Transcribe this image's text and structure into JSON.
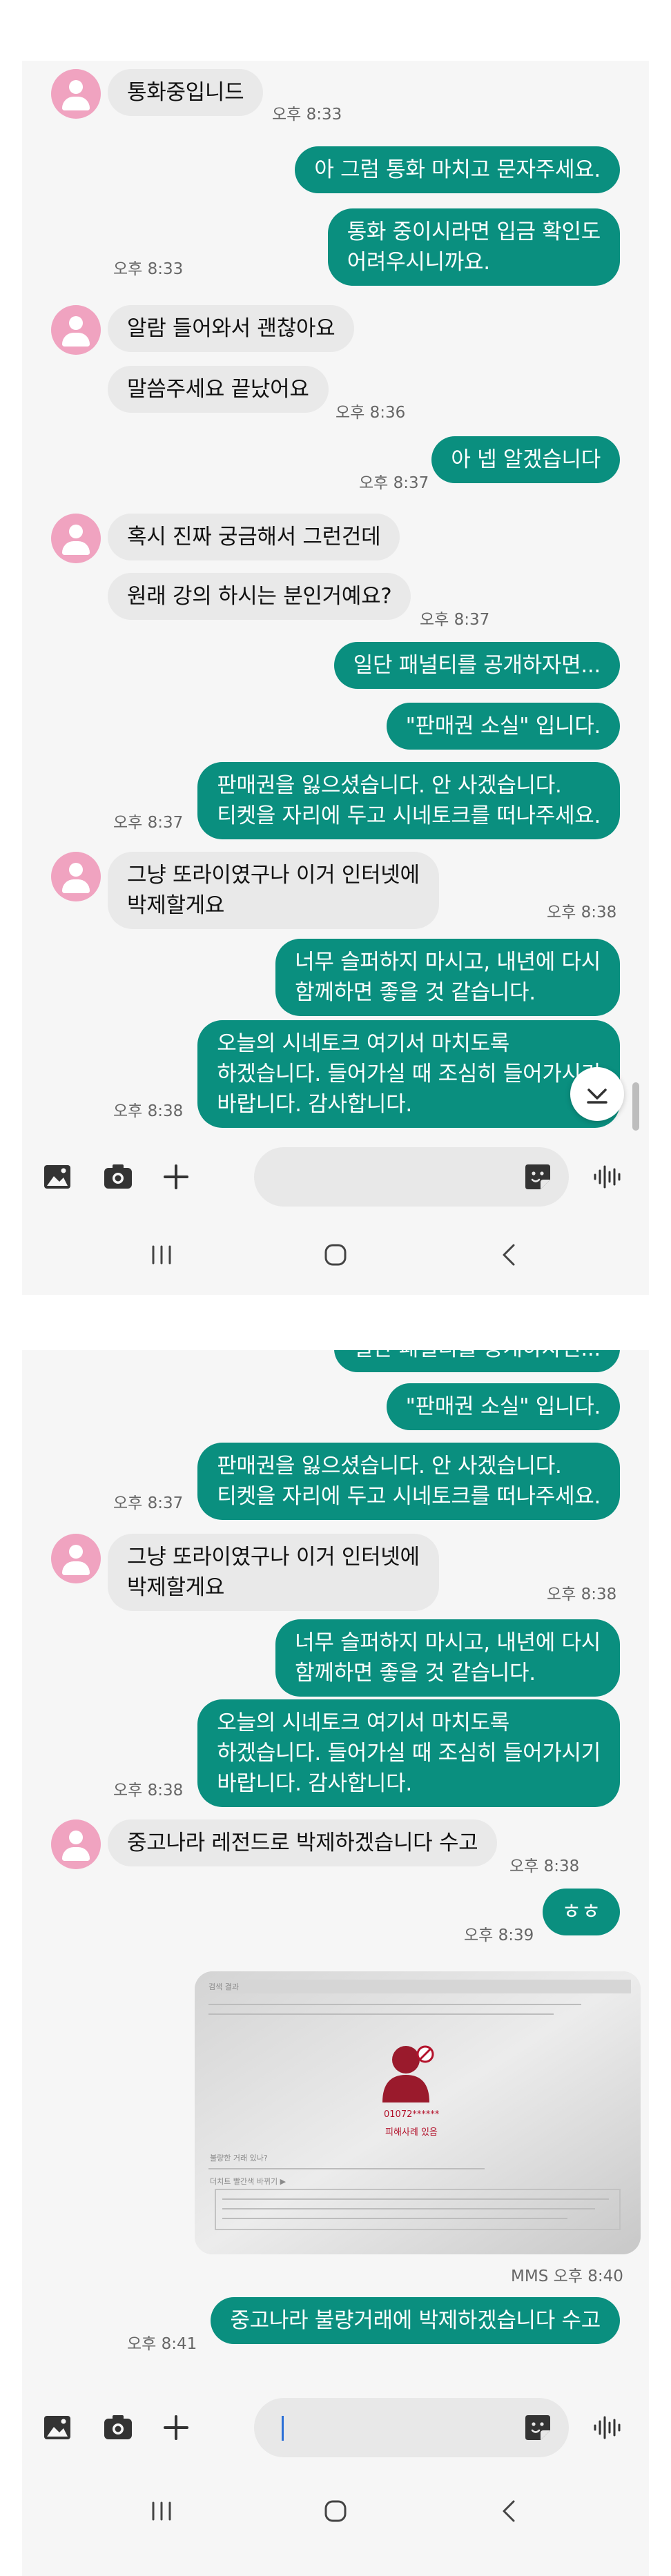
{
  "colors": {
    "outgoing_bubble": "#0a8f7f",
    "incoming_bubble": "#e9e9e9",
    "avatar": "#f0a3c0",
    "screen_background": "#f6f6f6",
    "warning_red": "#b3122b"
  },
  "screen1": {
    "messages": [
      {
        "direction": "in",
        "text": "통화중입니드",
        "time": "오후 8:33"
      },
      {
        "direction": "out",
        "text": "아 그럼 통화 마치고 문자주세요."
      },
      {
        "direction": "out",
        "text": "통화 중이시라면 입금 확인도\n어려우시니까요.",
        "time": "오후 8:33"
      },
      {
        "direction": "in",
        "text": "알람 들어와서 괜찮아요"
      },
      {
        "direction": "in",
        "text": "말씀주세요 끝났어요",
        "time": "오후 8:36"
      },
      {
        "direction": "out",
        "text": "아 넵 알겠습니다",
        "time": "오후 8:37"
      },
      {
        "direction": "in",
        "text": "혹시 진짜 궁금해서 그런건데"
      },
      {
        "direction": "in",
        "text": "원래 강의 하시는 분인거예요?",
        "time": "오후 8:37"
      },
      {
        "direction": "out",
        "text": "일단 패널티를 공개하자면..."
      },
      {
        "direction": "out",
        "text": "\"판매권 소실\" 입니다."
      },
      {
        "direction": "out",
        "text": "판매권을 잃으셨습니다. 안 사겠습니다.\n티켓을 자리에 두고 시네토크를 떠나주세요.",
        "time": "오후 8:37"
      },
      {
        "direction": "in",
        "text": "그냥 또라이였구나 이거 인터넷에\n박제할게요",
        "time": "오후 8:38"
      },
      {
        "direction": "out",
        "text": "너무 슬퍼하지 마시고, 내년에 다시\n함께하면 좋을 것 같습니다."
      },
      {
        "direction": "out",
        "text": "오늘의 시네토크 여기서 마치도록\n하겠습니다. 들어가실 때 조심히 들어가시기\n바랍니다. 감사합니다.",
        "time": "오후 8:38"
      }
    ]
  },
  "screen2": {
    "partial_top": "일단 패널티를 공개하자면...",
    "messages": [
      {
        "direction": "out",
        "text": "\"판매권 소실\" 입니다."
      },
      {
        "direction": "out",
        "text": "판매권을 잃으셨습니다. 안 사겠습니다.\n티켓을 자리에 두고 시네토크를 떠나주세요.",
        "time": "오후 8:37"
      },
      {
        "direction": "in",
        "text": "그냥 또라이였구나 이거 인터넷에\n박제할게요",
        "time": "오후 8:38"
      },
      {
        "direction": "out",
        "text": "너무 슬퍼하지 마시고, 내년에 다시\n함께하면 좋을 것 같습니다."
      },
      {
        "direction": "out",
        "text": "오늘의 시네토크 여기서 마치도록\n하겠습니다. 들어가실 때 조심히 들어가시기\n바랍니다. 감사합니다.",
        "time": "오후 8:38"
      },
      {
        "direction": "in",
        "text": "중고나라 레전드로 박제하겠습니다 수고",
        "time": "오후 8:38"
      },
      {
        "direction": "out",
        "text": "ㅎㅎ",
        "time": "오후 8:39"
      },
      {
        "direction": "out",
        "text": "중고나라 불량거래에 박제하겠습니다 수고",
        "time": "오후 8:41"
      }
    ],
    "attachment": {
      "meta": "MMS 오후 8:40",
      "screenshot_lines": [
        "검색 결과",
        "01072******",
        "피해사례 있음",
        "불량한 거래 있나?",
        "더치트 빨간색 바뀌기 ▶"
      ]
    }
  },
  "composer_icons": [
    "gallery-icon",
    "camera-icon",
    "plus-icon",
    "sticker-icon",
    "voice-icon"
  ],
  "navbar_icons": [
    "recent-apps-icon",
    "home-icon",
    "back-icon"
  ]
}
